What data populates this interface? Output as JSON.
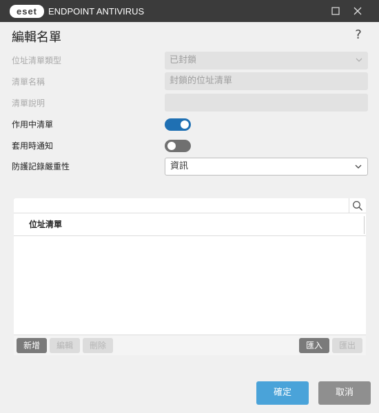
{
  "app": {
    "brand": "eset",
    "product": "ENDPOINT ANTIVIRUS"
  },
  "dialog": {
    "title": "編輯名單",
    "help": "?"
  },
  "form": {
    "list_type": {
      "label": "位址清單類型",
      "value": "已封鎖"
    },
    "list_name": {
      "label": "清單名稱",
      "value": "封鎖的位址清單"
    },
    "list_description": {
      "label": "清單說明",
      "value": ""
    },
    "list_active": {
      "label": "作用中清單",
      "checked": true
    },
    "notify_on_apply": {
      "label": "套用時通知",
      "checked": false
    },
    "log_severity": {
      "label": "防護記錄嚴重性",
      "value": "資訊"
    }
  },
  "list": {
    "search_value": "",
    "column_header": "位址清單",
    "items": [],
    "buttons": {
      "add": "新增",
      "edit": "編輯",
      "delete": "刪除",
      "import": "匯入",
      "export": "匯出"
    }
  },
  "footer": {
    "ok": "確定",
    "cancel": "取消"
  },
  "colors": {
    "titlebar": "#3b3b3b",
    "toggle_on": "#1f70b3",
    "primary_button": "#4aa3d9",
    "secondary_button": "#8f8f8f"
  }
}
